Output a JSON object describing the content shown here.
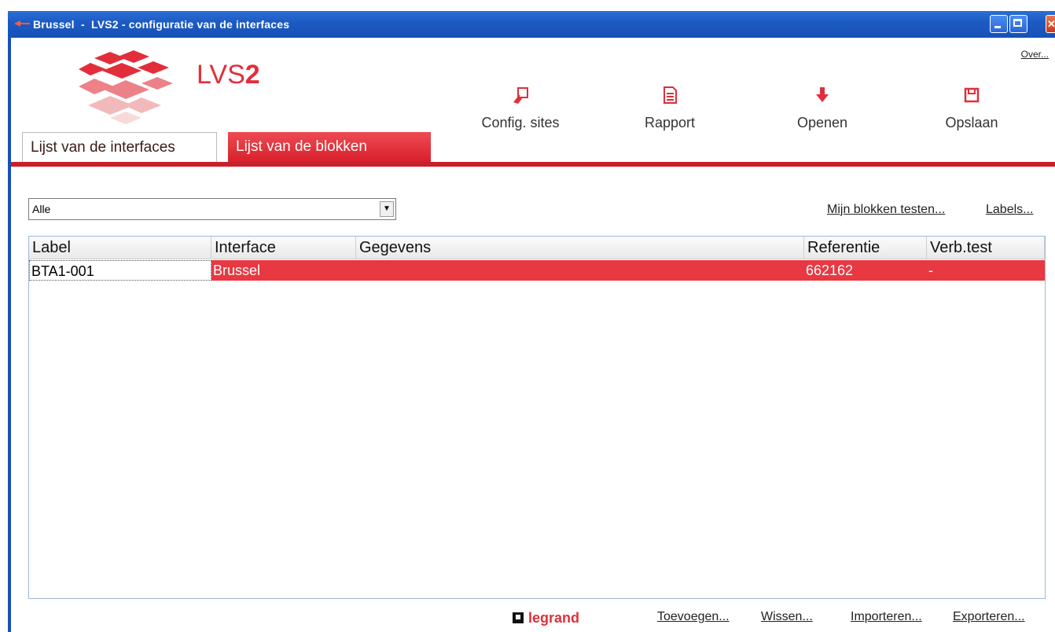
{
  "window": {
    "title": "Brussel  -  LVS2 - configuratie van de interfaces",
    "accent": "#1651b6"
  },
  "header": {
    "app_name_light": "LVS",
    "app_name_bold": "2",
    "over_link": "Over...",
    "brand_color": "#e22e3a"
  },
  "toolbar": {
    "config_sites": "Config. sites",
    "rapport": "Rapport",
    "openen": "Openen",
    "opslaan": "Opslaan"
  },
  "tabs": [
    {
      "label": "Lijst van de interfaces",
      "active": false
    },
    {
      "label": "Lijst van de blokken",
      "active": true
    }
  ],
  "filter": {
    "selected": "Alle"
  },
  "links": {
    "test_blocks": "Mijn blokken testen...",
    "labels": "Labels..."
  },
  "table": {
    "columns": [
      "Label",
      "Interface",
      "Gegevens",
      "Referentie",
      "Verb.test"
    ],
    "rows": [
      {
        "label": "BTA1-001",
        "interface": "Brussel",
        "gegevens": "",
        "referentie": "662162",
        "verb_test": "-"
      }
    ],
    "selected_color": "#e83841"
  },
  "footer": {
    "brand": "legrand",
    "toevoegen": "Toevoegen...",
    "wissen": "Wissen...",
    "importeren": "Importeren...",
    "exporteren": "Exporteren..."
  }
}
